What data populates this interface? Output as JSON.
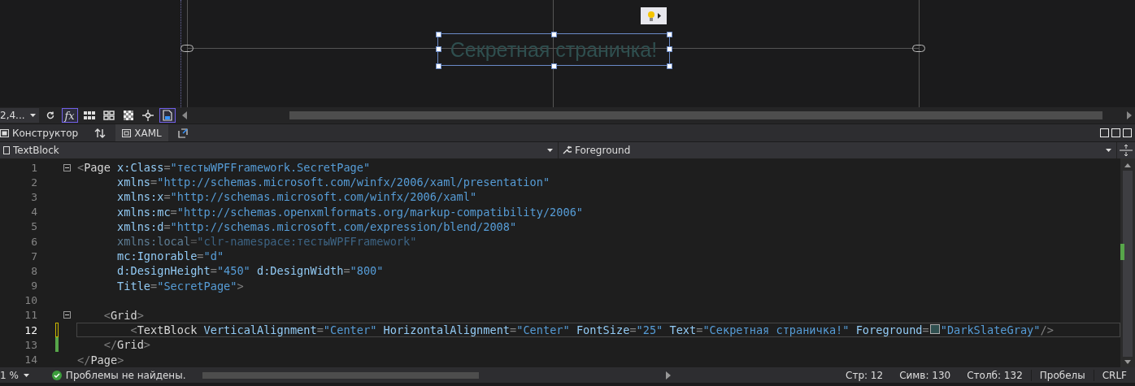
{
  "designer": {
    "text_block": "Секретная страничка!",
    "selected": true
  },
  "designer_toolbar": {
    "zoom": "2,4...",
    "buttons": [
      {
        "kind": "refresh",
        "on": false
      },
      {
        "kind": "fx",
        "label": "fx",
        "on": true
      },
      {
        "kind": "grid",
        "on": false
      },
      {
        "kind": "snap",
        "on": false
      },
      {
        "kind": "checker",
        "on": false
      },
      {
        "kind": "crosshair",
        "on": false
      },
      {
        "kind": "device",
        "on": true
      }
    ]
  },
  "tabs": [
    {
      "label": "Конструктор",
      "kind": "design",
      "selected": false
    },
    {
      "label": "XAML",
      "kind": "xaml",
      "selected": true
    }
  ],
  "nav_bar": {
    "element": "TextBlock",
    "member": "Foreground"
  },
  "code_lines": [
    {
      "number": "1",
      "current": false,
      "dimmed": false,
      "foldable": true,
      "unsaved_change": false,
      "saved_change": false,
      "tokens": [
        {
          "kind": "punct",
          "text": "<"
        },
        {
          "kind": "tag",
          "text": "Page"
        },
        {
          "kind": "attr",
          "text": " x:Class"
        },
        {
          "kind": "punct",
          "text": "="
        },
        {
          "kind": "value",
          "text": "\"тестыWPFFramework.SecretPage\""
        }
      ]
    },
    {
      "number": "2",
      "current": false,
      "dimmed": false,
      "foldable": false,
      "unsaved_change": false,
      "saved_change": false,
      "tokens": [
        {
          "kind": "attr",
          "text": "      xmlns"
        },
        {
          "kind": "punct",
          "text": "="
        },
        {
          "kind": "value",
          "text": "\"http://schemas.microsoft.com/winfx/2006/xaml/presentation\""
        }
      ]
    },
    {
      "number": "3",
      "current": false,
      "dimmed": false,
      "foldable": false,
      "unsaved_change": false,
      "saved_change": false,
      "tokens": [
        {
          "kind": "attr",
          "text": "      xmlns:x"
        },
        {
          "kind": "punct",
          "text": "="
        },
        {
          "kind": "value",
          "text": "\"http://schemas.microsoft.com/winfx/2006/xaml\""
        }
      ]
    },
    {
      "number": "4",
      "current": false,
      "dimmed": false,
      "foldable": false,
      "unsaved_change": false,
      "saved_change": false,
      "tokens": [
        {
          "kind": "attr",
          "text": "      xmlns:mc"
        },
        {
          "kind": "punct",
          "text": "="
        },
        {
          "kind": "value",
          "text": "\"http://schemas.openxmlformats.org/markup-compatibility/2006\""
        }
      ]
    },
    {
      "number": "5",
      "current": false,
      "dimmed": false,
      "foldable": false,
      "unsaved_change": false,
      "saved_change": false,
      "tokens": [
        {
          "kind": "attr",
          "text": "      xmlns:d"
        },
        {
          "kind": "punct",
          "text": "="
        },
        {
          "kind": "value",
          "text": "\"http://schemas.microsoft.com/expression/blend/2008\""
        }
      ]
    },
    {
      "number": "6",
      "current": false,
      "dimmed": true,
      "foldable": false,
      "unsaved_change": false,
      "saved_change": false,
      "tokens": [
        {
          "kind": "attr",
          "text": "      xmlns:local"
        },
        {
          "kind": "punct",
          "text": "="
        },
        {
          "kind": "value",
          "text": "\"clr-namespace:тестыWPFFramework\""
        }
      ]
    },
    {
      "number": "7",
      "current": false,
      "dimmed": false,
      "foldable": false,
      "unsaved_change": false,
      "saved_change": false,
      "tokens": [
        {
          "kind": "attr",
          "text": "      mc:Ignorable"
        },
        {
          "kind": "punct",
          "text": "="
        },
        {
          "kind": "value",
          "text": "\"d\""
        }
      ]
    },
    {
      "number": "8",
      "current": false,
      "dimmed": false,
      "foldable": false,
      "unsaved_change": false,
      "saved_change": false,
      "tokens": [
        {
          "kind": "attr",
          "text": "      d:DesignHeight"
        },
        {
          "kind": "punct",
          "text": "="
        },
        {
          "kind": "value",
          "text": "\"450\""
        },
        {
          "kind": "attr",
          "text": " d:DesignWidth"
        },
        {
          "kind": "punct",
          "text": "="
        },
        {
          "kind": "value",
          "text": "\"800\""
        }
      ]
    },
    {
      "number": "9",
      "current": false,
      "dimmed": false,
      "foldable": false,
      "unsaved_change": false,
      "saved_change": false,
      "tokens": [
        {
          "kind": "attr",
          "text": "      Title"
        },
        {
          "kind": "punct",
          "text": "="
        },
        {
          "kind": "value",
          "text": "\"SecretPage\""
        },
        {
          "kind": "punct",
          "text": ">"
        }
      ]
    },
    {
      "number": "10",
      "current": false,
      "foldable": false,
      "unsaved_change": false,
      "saved_change": false
    },
    {
      "number": "11",
      "current": false,
      "dimmed": false,
      "foldable": true,
      "unsaved_change": false,
      "saved_change": false,
      "tokens": [
        {
          "kind": "punct",
          "text": "    <"
        },
        {
          "kind": "tag",
          "text": "Grid"
        },
        {
          "kind": "punct",
          "text": ">"
        }
      ]
    },
    {
      "number": "12",
      "current": true,
      "dimmed": false,
      "foldable": false,
      "unsaved_change": true,
      "saved_change": false,
      "tokens": [
        {
          "kind": "punct",
          "text": "        <"
        },
        {
          "kind": "tag",
          "text": "TextBlock"
        },
        {
          "kind": "attr",
          "text": " VerticalAlignment"
        },
        {
          "kind": "punct",
          "text": "="
        },
        {
          "kind": "value",
          "text": "\"Center\""
        },
        {
          "kind": "attr",
          "text": " HorizontalAlignment"
        },
        {
          "kind": "punct",
          "text": "="
        },
        {
          "kind": "value",
          "text": "\"Center\""
        },
        {
          "kind": "attr",
          "text": " FontSize"
        },
        {
          "kind": "punct",
          "text": "="
        },
        {
          "kind": "value",
          "text": "\"25\""
        },
        {
          "kind": "attr",
          "text": " Text"
        },
        {
          "kind": "punct",
          "text": "="
        },
        {
          "kind": "value",
          "text": "\"Секретная страничка!\""
        },
        {
          "kind": "attr",
          "text": " Foreground"
        },
        {
          "kind": "punct",
          "text": "="
        },
        {
          "kind": "swatch",
          "color": "#2f4f4f"
        },
        {
          "kind": "value",
          "text": "\"DarkSlateGray\""
        },
        {
          "kind": "punct",
          "text": "/>"
        }
      ]
    },
    {
      "number": "13",
      "current": false,
      "dimmed": false,
      "foldable": false,
      "unsaved_change": false,
      "saved_change": true,
      "tokens": [
        {
          "kind": "punct",
          "text": "    </"
        },
        {
          "kind": "tag",
          "text": "Grid"
        },
        {
          "kind": "punct",
          "text": ">"
        }
      ]
    },
    {
      "number": "14",
      "current": false,
      "dimmed": false,
      "foldable": false,
      "unsaved_change": false,
      "saved_change": false,
      "tokens": [
        {
          "kind": "punct",
          "text": "</"
        },
        {
          "kind": "tag",
          "text": "Page"
        },
        {
          "kind": "punct",
          "text": ">"
        }
      ]
    }
  ],
  "status_bar": {
    "zoom": "1 %",
    "problems": "Проблемы не найдены.",
    "line": "Стр: 12",
    "char": "Симв: 130",
    "column": "Столб: 132",
    "indent": "Пробелы",
    "line_ending": "CRLF"
  }
}
